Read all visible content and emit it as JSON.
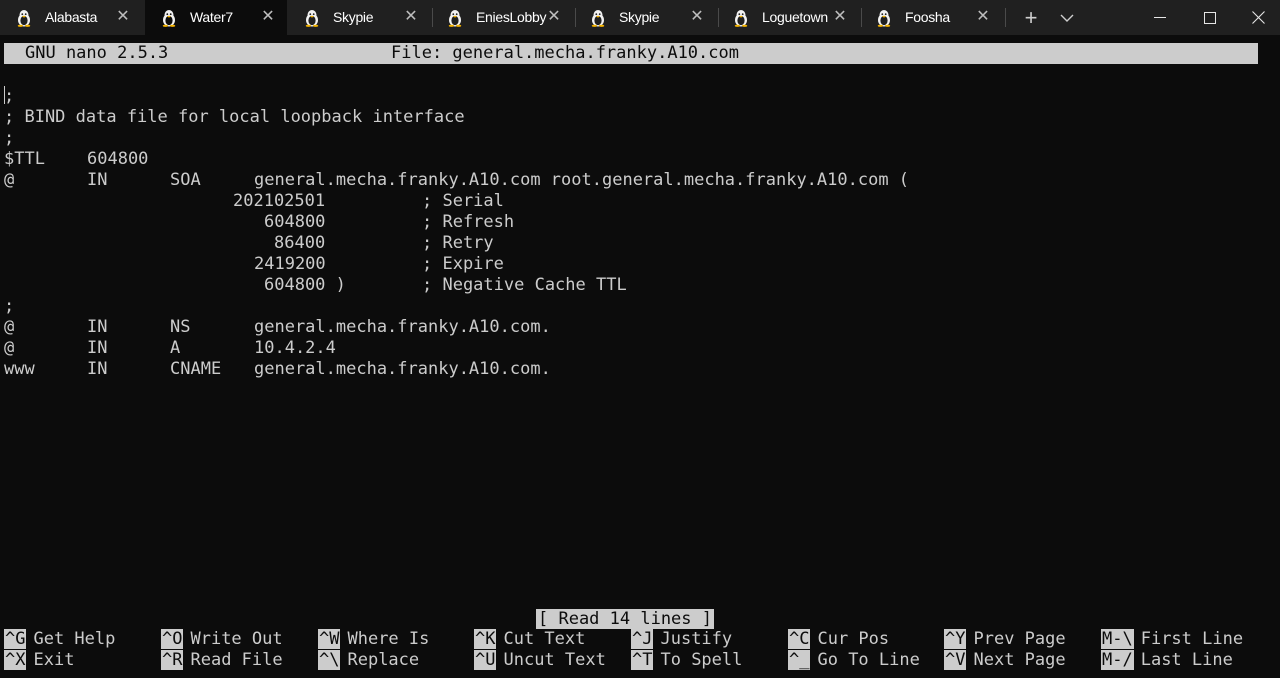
{
  "tabs": [
    {
      "title": "Alabasta",
      "active": false
    },
    {
      "title": "Water7",
      "active": true
    },
    {
      "title": "Skypie",
      "active": false
    },
    {
      "title": "EniesLobby",
      "active": false
    },
    {
      "title": "Skypie",
      "active": false
    },
    {
      "title": "Loguetown",
      "active": false
    },
    {
      "title": "Foosha",
      "active": false
    }
  ],
  "window_controls": {
    "new_tab": "+",
    "dropdown": "⌄",
    "minimize": "—",
    "maximize": "☐",
    "close": "✕"
  },
  "nano": {
    "version": "GNU nano 2.5.3",
    "file_label": "File: general.mecha.franky.A10.com",
    "status": "[ Read 14 lines ]"
  },
  "lines": [
    {
      "c": [
        ";"
      ]
    },
    {
      "c": [
        "; BIND data file for local loopback interface"
      ]
    },
    {
      "c": [
        ";"
      ]
    },
    {
      "c": [
        "$TTL",
        "604800"
      ]
    },
    {
      "c": [
        "@",
        "IN",
        "SOA",
        "general.mecha.franky.A10.com root.general.mecha.franky.A10.com ("
      ]
    },
    {
      "c": [
        "202102501",
        "; Serial"
      ]
    },
    {
      "c": [
        "604800",
        "; Refresh"
      ]
    },
    {
      "c": [
        "86400",
        "; Retry"
      ]
    },
    {
      "c": [
        "2419200",
        "; Expire"
      ]
    },
    {
      "c": [
        "604800 )",
        "; Negative Cache TTL"
      ]
    },
    {
      "c": [
        ";"
      ]
    },
    {
      "c": [
        "@",
        "IN",
        "NS",
        "general.mecha.franky.A10.com."
      ]
    },
    {
      "c": [
        "@",
        "IN",
        "A",
        "10.4.2.4"
      ]
    },
    {
      "c": [
        "www",
        "IN",
        "CNAME",
        "general.mecha.franky.A10.com."
      ]
    }
  ],
  "shortcuts": [
    {
      "key": "^G",
      "label": "Get Help"
    },
    {
      "key": "^O",
      "label": "Write Out"
    },
    {
      "key": "^W",
      "label": "Where Is"
    },
    {
      "key": "^K",
      "label": "Cut Text"
    },
    {
      "key": "^J",
      "label": "Justify"
    },
    {
      "key": "^C",
      "label": "Cur Pos"
    },
    {
      "key": "^Y",
      "label": "Prev Page"
    },
    {
      "key": "M-\\",
      "label": "First Line"
    },
    {
      "key": "^X",
      "label": "Exit"
    },
    {
      "key": "^R",
      "label": "Read File"
    },
    {
      "key": "^\\",
      "label": "Replace"
    },
    {
      "key": "^U",
      "label": "Uncut Text"
    },
    {
      "key": "^T",
      "label": "To Spell"
    },
    {
      "key": "^_",
      "label": "Go To Line"
    },
    {
      "key": "^V",
      "label": "Next Page"
    },
    {
      "key": "M-/",
      "label": "Last Line"
    }
  ]
}
